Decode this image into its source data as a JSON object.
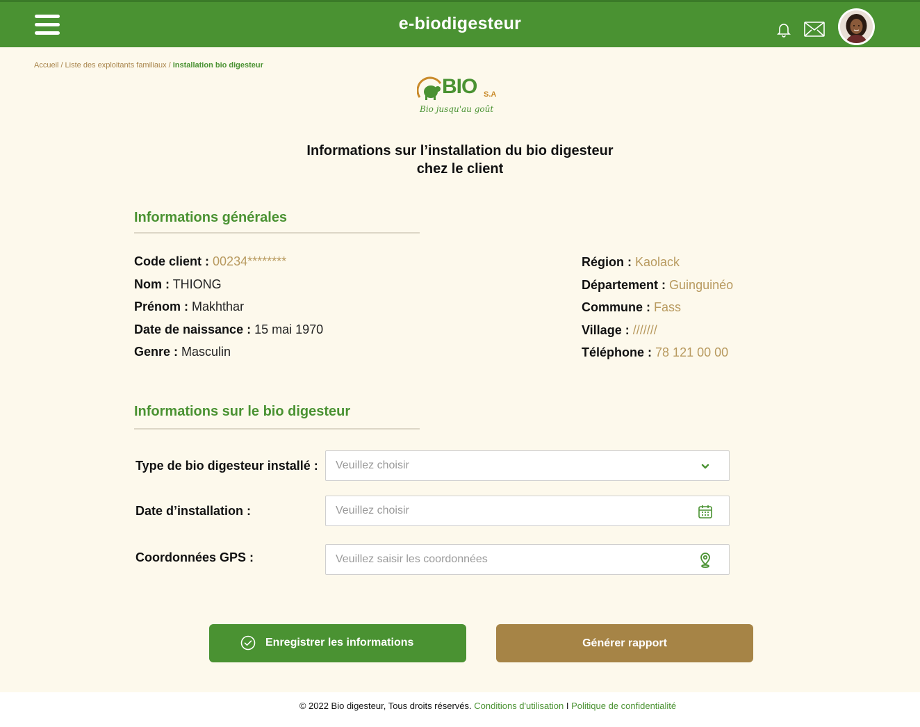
{
  "header": {
    "title": "e-biodigesteur",
    "menu_icon": "hamburger-menu-icon",
    "notification_icon": "bell-icon",
    "message_icon": "mail-icon",
    "avatar": "user-avatar"
  },
  "breadcrumb": {
    "items": [
      "Accueil",
      "Liste des exploitants familiaux"
    ],
    "current": "Installation bio digesteur",
    "separator": "/"
  },
  "logo": {
    "word": "BIO",
    "suffix": "S.A",
    "tagline": "Bio jusqu'au goût"
  },
  "page": {
    "title_line1": "Informations sur l’installation du bio digesteur",
    "title_line2": "chez le client"
  },
  "general": {
    "title": "Informations générales",
    "left": [
      {
        "label": "Code client :",
        "value": "00234********"
      },
      {
        "label": "Nom :",
        "value": "THIONG"
      },
      {
        "label": "Prénom :",
        "value": "Makhthar"
      },
      {
        "label": "Date de naissance :",
        "value": "15 mai 1970"
      },
      {
        "label": "Genre :",
        "value": "Masculin"
      }
    ],
    "right": [
      {
        "label": "Région :",
        "value": "Kaolack"
      },
      {
        "label": "Département :",
        "value": "Guinguinéo"
      },
      {
        "label": "Commune :",
        "value": "Fass"
      },
      {
        "label": "Village :",
        "value": "///////"
      },
      {
        "label": "Téléphone :",
        "value": "78 121 00 00"
      }
    ]
  },
  "biodigester": {
    "title": "Informations sur le bio digesteur",
    "fields": [
      {
        "label": "Type de bio digesteur installé :",
        "placeholder": "Veuillez choisir",
        "icon": "chevron-down-icon"
      },
      {
        "label": "Date d’installation :",
        "placeholder": "Veuillez choisir",
        "icon": "calendar-icon"
      },
      {
        "label": "Coordonnées GPS :",
        "placeholder": "Veuillez saisir les coordonnées",
        "icon": "map-pin-icon"
      }
    ]
  },
  "actions": {
    "save_label": "Enregistrer les informations",
    "save_icon": "check-circle-icon",
    "report_label": "Générer rapport"
  },
  "footer": {
    "copyright": "© 2022 Bio digesteur, Tous droits réservés.",
    "terms": "Conditions d'utilisation",
    "divider": "I",
    "privacy": "Politique de confidentialité"
  },
  "colors": {
    "primary_green": "#4a9232",
    "gold": "#a68446",
    "value_gold": "#b89a5f",
    "background": "#fdf9ec"
  }
}
